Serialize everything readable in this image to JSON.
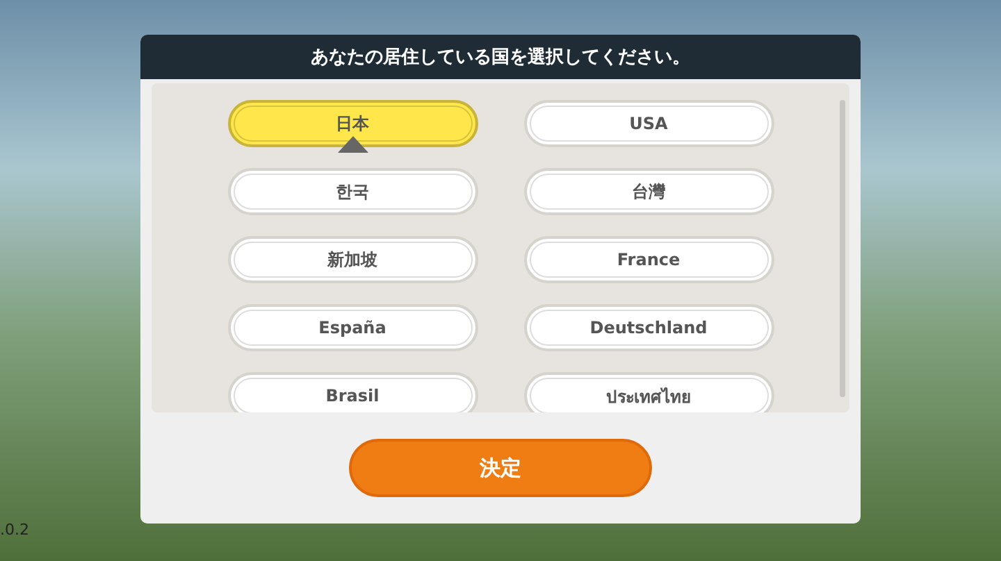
{
  "background": {
    "version": ".0.2"
  },
  "dialog": {
    "title": "あなたの居住している国を選択してください。",
    "countries": [
      {
        "label": "日本",
        "selected": true
      },
      {
        "label": "USA",
        "selected": false
      },
      {
        "label": "한국",
        "selected": false
      },
      {
        "label": "台灣",
        "selected": false
      },
      {
        "label": "新加坡",
        "selected": false
      },
      {
        "label": "France",
        "selected": false
      },
      {
        "label": "España",
        "selected": false
      },
      {
        "label": "Deutschland",
        "selected": false
      },
      {
        "label": "Brasil",
        "selected": false
      },
      {
        "label": "ประเทศไทย",
        "selected": false
      }
    ],
    "confirm_button": "決定"
  }
}
